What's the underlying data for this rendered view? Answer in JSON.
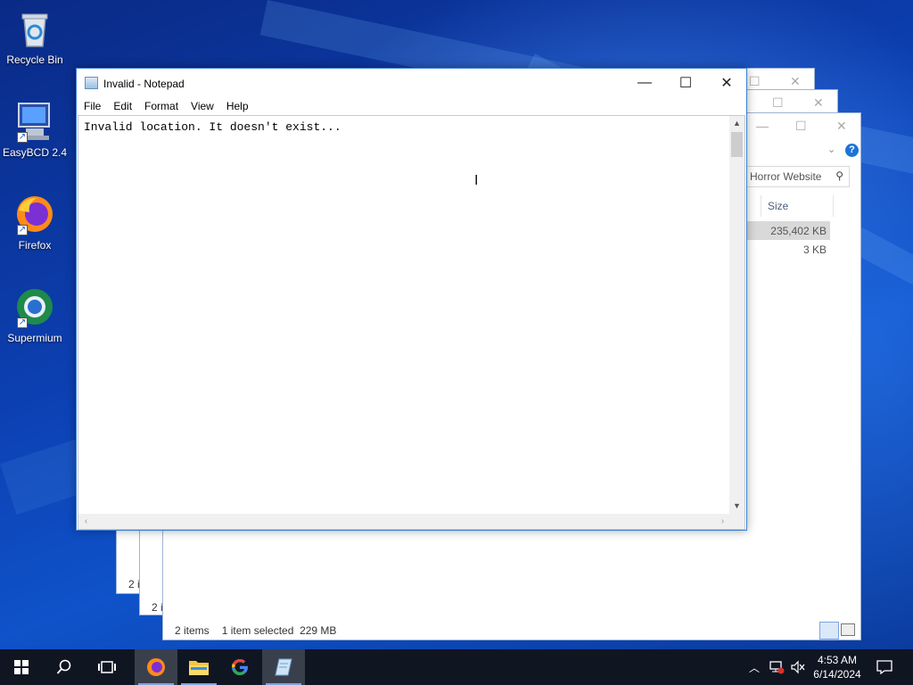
{
  "desktop": {
    "icons": [
      {
        "label": "Recycle Bin"
      },
      {
        "label": "EasyBCD 2.4"
      },
      {
        "label": "Firefox"
      },
      {
        "label": "Supermium"
      }
    ]
  },
  "explorer": {
    "search_text": "Horror Website",
    "size_header": "Size",
    "rows": [
      {
        "size": "235,402 KB"
      },
      {
        "size": "3 KB"
      }
    ],
    "status_items": "2 items",
    "status_selected": "1 item selected",
    "status_size": "229 MB",
    "partial_items_1": "2 i",
    "partial_items_2": "2 i"
  },
  "notepad": {
    "title": "Invalid - Notepad",
    "menu": [
      "File",
      "Edit",
      "Format",
      "View",
      "Help"
    ],
    "content": "Invalid location. It doesn't exist..."
  },
  "taskbar": {
    "time": "4:53 AM",
    "date": "6/14/2024"
  },
  "colors": {
    "accent": "#3b7fd4",
    "taskbar_bg": "#101522"
  }
}
